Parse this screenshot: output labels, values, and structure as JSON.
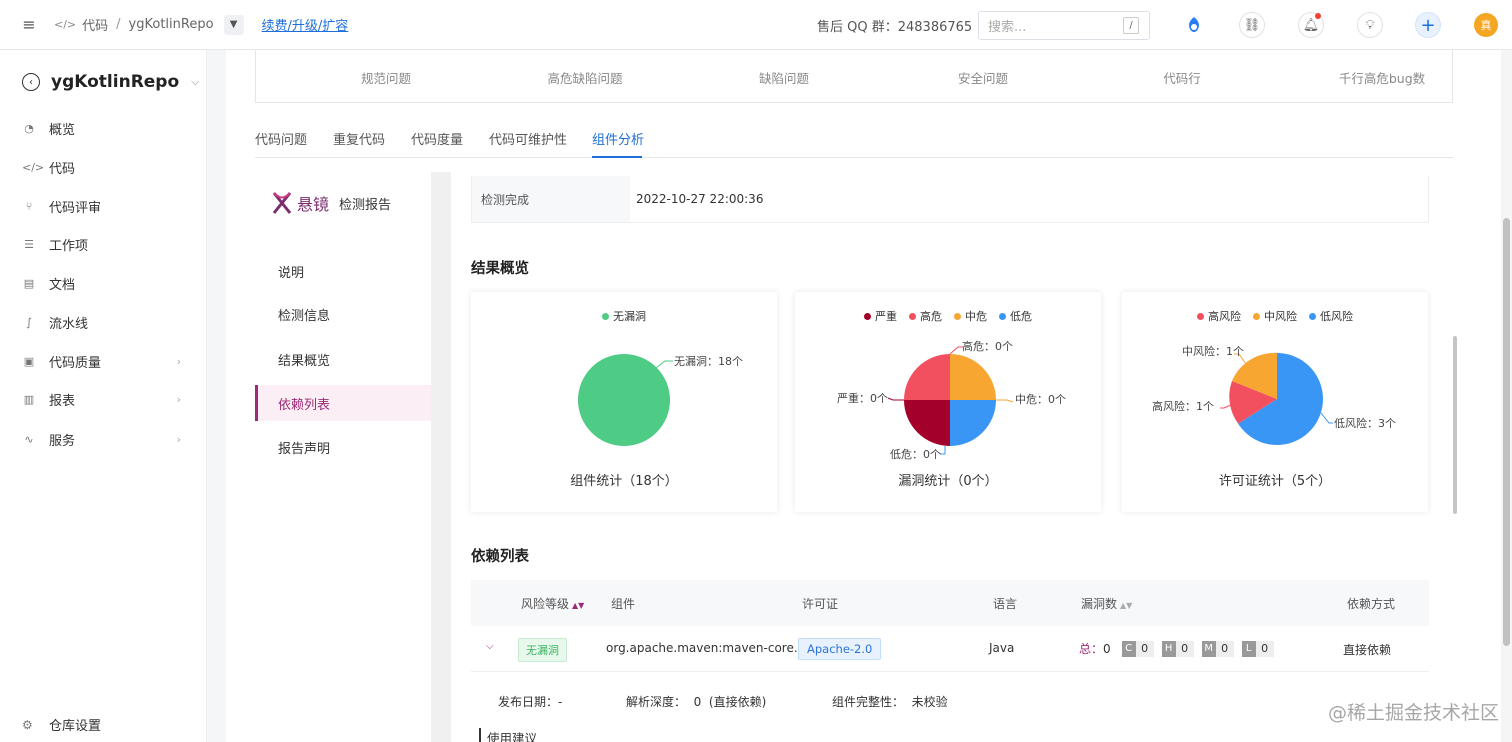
{
  "topbar": {
    "breadcrumb": [
      "代码",
      "ygKotlinRepo"
    ],
    "upgrade_link": "续费/升级/扩容",
    "qq_group": "售后 QQ 群：248386765",
    "search_placeholder": "搜索...",
    "search_shortcut": "/",
    "avatar_text": "真"
  },
  "sidebar": {
    "repo_name": "ygKotlinRepo",
    "items": [
      {
        "label": "概览",
        "icon": "dashboard-icon"
      },
      {
        "label": "代码",
        "icon": "code-icon"
      },
      {
        "label": "代码评审",
        "icon": "merge-request-icon"
      },
      {
        "label": "工作项",
        "icon": "list-icon"
      },
      {
        "label": "文档",
        "icon": "document-icon"
      },
      {
        "label": "流水线",
        "icon": "pipeline-icon"
      },
      {
        "label": "代码质量",
        "icon": "quality-icon"
      },
      {
        "label": "报表",
        "icon": "bar-chart-icon"
      },
      {
        "label": "服务",
        "icon": "service-icon"
      }
    ],
    "settings_label": "仓库设置"
  },
  "stats": [
    {
      "label": "规范问题"
    },
    {
      "label": "高危缺陷问题"
    },
    {
      "label": "缺陷问题"
    },
    {
      "label": "安全问题"
    },
    {
      "label": "代码行"
    },
    {
      "label": "千行高危bug数"
    }
  ],
  "tabs": [
    "代码问题",
    "重复代码",
    "代码度量",
    "代码可维护性",
    "组件分析"
  ],
  "active_tab": "组件分析",
  "report_nav": {
    "brand": "悬镜",
    "title": "检测报告",
    "items": [
      "说明",
      "检测信息",
      "结果概览",
      "依赖列表",
      "报告声明"
    ],
    "active": "依赖列表"
  },
  "detection": {
    "key": "检测完成",
    "value": "2022-10-27 22:00:36"
  },
  "overview_title": "结果概览",
  "charts": {
    "components": {
      "caption": "组件统计（18个）",
      "legend": [
        {
          "name": "无漏洞",
          "color": "#4ecb84"
        }
      ],
      "labels": [
        "无漏洞：18个"
      ]
    },
    "vulnerabilities": {
      "caption": "漏洞统计（0个）",
      "legend": [
        {
          "name": "严重",
          "color": "#a3002b"
        },
        {
          "name": "高危",
          "color": "#f2505f"
        },
        {
          "name": "中危",
          "color": "#f8a632"
        },
        {
          "name": "低危",
          "color": "#3a96f5"
        }
      ],
      "labels": [
        "高危：0个",
        "严重：0个",
        "中危：0个",
        "低危：0个"
      ]
    },
    "licenses": {
      "caption": "许可证统计（5个）",
      "legend": [
        {
          "name": "高风险",
          "color": "#f2505f"
        },
        {
          "name": "中风险",
          "color": "#f8a632"
        },
        {
          "name": "低风险",
          "color": "#3a96f5"
        }
      ],
      "labels": [
        "中风险：1个",
        "高风险：1个",
        "低风险：3个"
      ]
    }
  },
  "chart_data": [
    {
      "type": "pie",
      "categories": [
        "无漏洞"
      ],
      "values": [
        18
      ]
    },
    {
      "type": "pie",
      "categories": [
        "严重",
        "高危",
        "中危",
        "低危"
      ],
      "values": [
        0,
        0,
        0,
        0
      ]
    },
    {
      "type": "pie",
      "categories": [
        "高风险",
        "中风险",
        "低风险"
      ],
      "values": [
        1,
        1,
        3
      ]
    }
  ],
  "deps_title": "依赖列表",
  "table": {
    "headers": [
      "风险等级",
      "组件",
      "许可证",
      "语言",
      "漏洞数",
      "依赖方式"
    ],
    "rows": [
      {
        "risk": "无漏洞",
        "component": "org.apache.maven:maven-core...",
        "license": "Apache-2.0",
        "language": "Java",
        "total_label": "总：",
        "total": "0",
        "counts": [
          {
            "l": "C",
            "n": "0"
          },
          {
            "l": "H",
            "n": "0"
          },
          {
            "l": "M",
            "n": "0"
          },
          {
            "l": "L",
            "n": "0"
          }
        ],
        "dep_type": "直接依赖"
      }
    ],
    "detail": {
      "release": "发布日期：-",
      "depth": "解析深度：  0  (直接依赖)",
      "integrity": "组件完整性：  未校验",
      "usage": "使用建议"
    }
  },
  "watermark": "@稀土掘金技术社区"
}
